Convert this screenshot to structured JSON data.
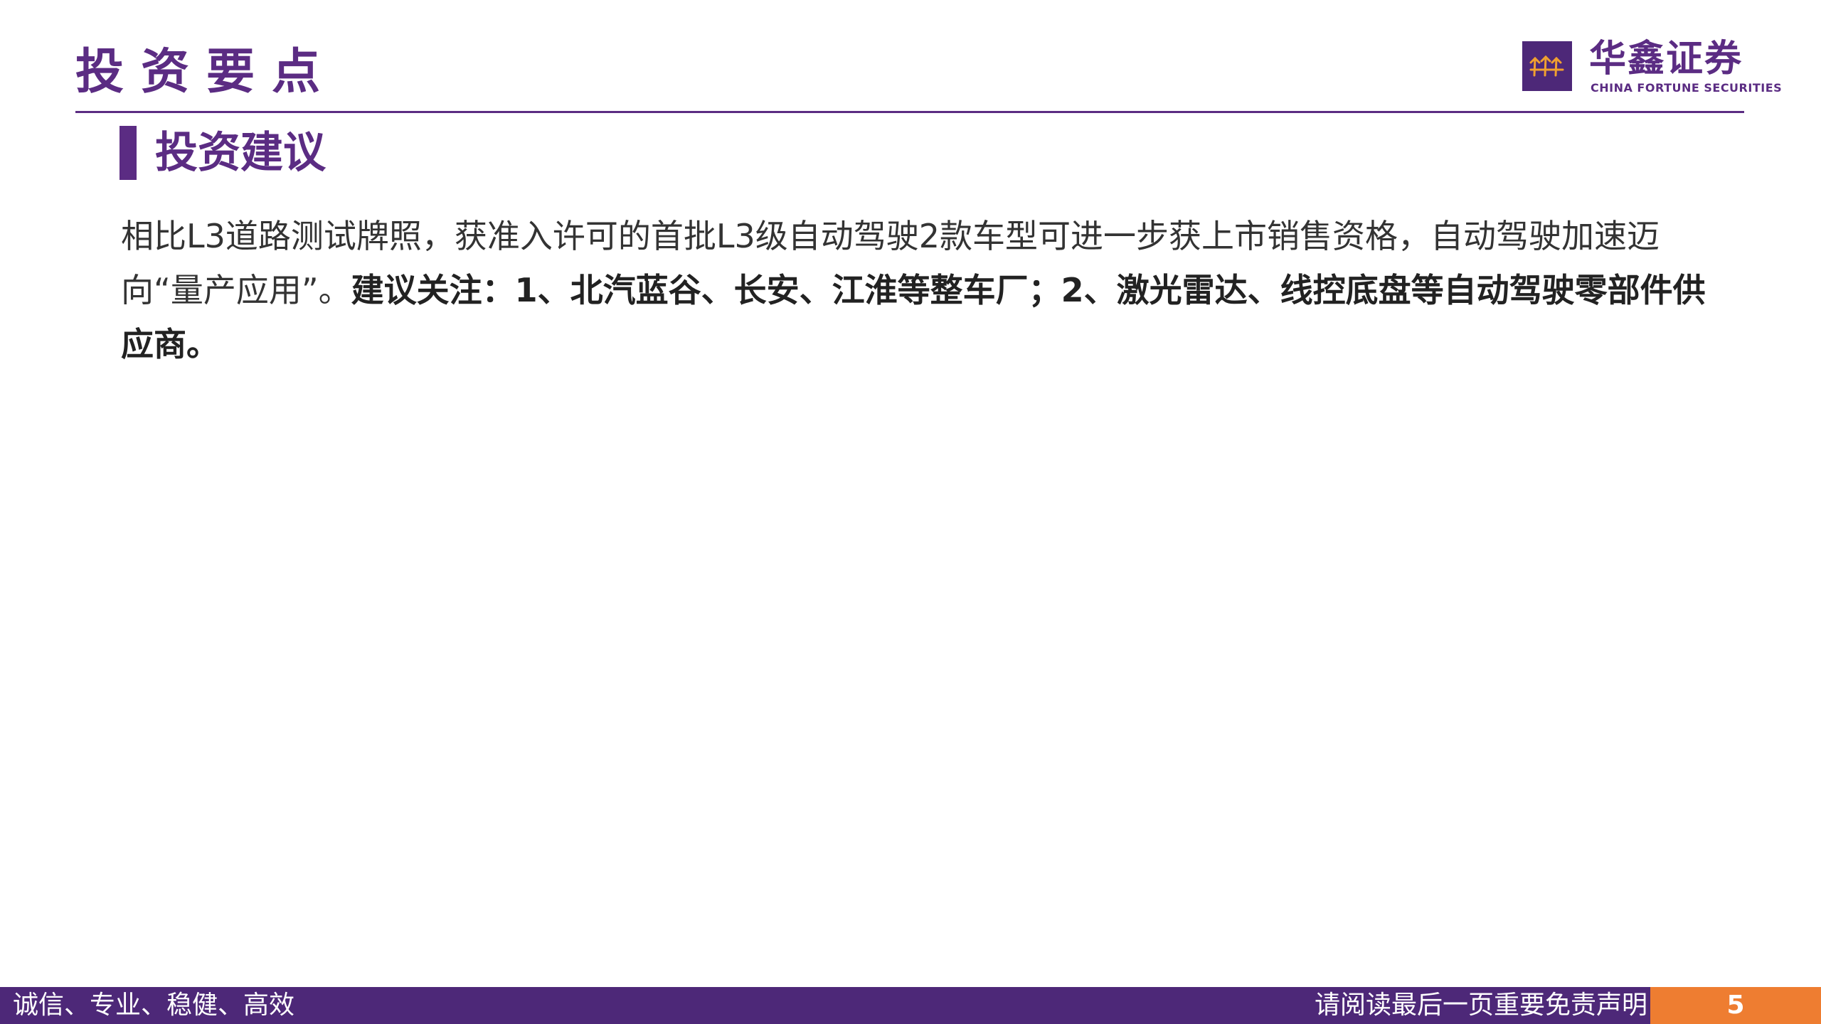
{
  "header": {
    "title": "投资要点"
  },
  "logo": {
    "icon": "huaxin-logo-mark",
    "name_cn": "华鑫证券",
    "name_en": "CHINA FORTUNE SECURITIES"
  },
  "section": {
    "title": "投资建议"
  },
  "body": {
    "normal": "相比L3道路测试牌照，获准入许可的首批L3级自动驾驶2款车型可进一步获上市销售资格，自动驾驶加速迈向“量产应用”。",
    "bold": "建议关注：1、北汽蓝谷、长安、江淮等整车厂；2、激光雷达、线控底盘等自动驾驶零部件供应商。"
  },
  "footer": {
    "slogan": "诚信、专业、稳健、高效",
    "disclaimer": "请阅读最后一页重要免责声明",
    "page_number": "5"
  },
  "colors": {
    "brand_purple": "#5b2c83",
    "footer_purple": "#4d2878",
    "accent_orange": "#ee7d31"
  }
}
